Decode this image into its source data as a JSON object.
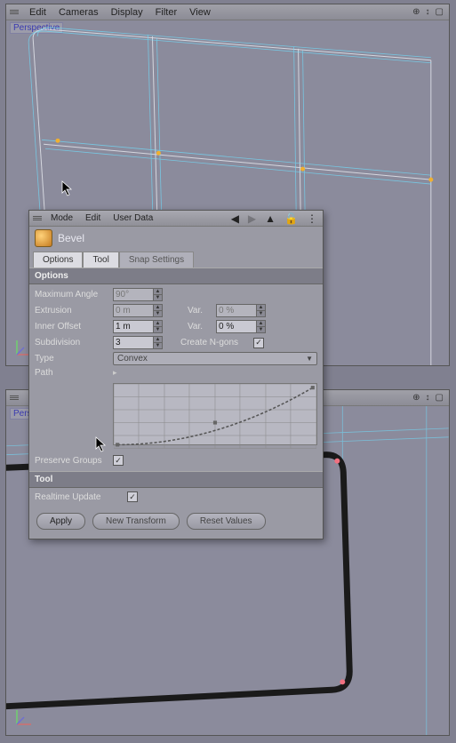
{
  "top_menu": {
    "items": [
      "Edit",
      "Cameras",
      "Display",
      "Filter",
      "View"
    ]
  },
  "viewport_label": "Perspective",
  "dialog": {
    "menus": [
      "Mode",
      "Edit",
      "User Data"
    ],
    "tool_name": "Bevel",
    "tabs": {
      "options": "Options",
      "tool": "Tool",
      "snap": "Snap Settings"
    },
    "sections": {
      "options": "Options",
      "tool": "Tool"
    },
    "params": {
      "max_angle_label": "Maximum Angle",
      "max_angle_value": "90°",
      "extrusion_label": "Extrusion",
      "extrusion_value": "0 m",
      "extrusion_var_label": "Var.",
      "extrusion_var_value": "0 %",
      "inner_offset_label": "Inner Offset",
      "inner_offset_value": "1 m",
      "inner_var_label": "Var.",
      "inner_var_value": "0 %",
      "subdivision_label": "Subdivision",
      "subdivision_value": "3",
      "ngons_label": "Create N-gons",
      "ngons_checked": true,
      "type_label": "Type",
      "type_value": "Convex",
      "path_label": "Path",
      "preserve_label": "Preserve Groups",
      "preserve_checked": true,
      "realtime_label": "Realtime Update",
      "realtime_checked": true
    },
    "buttons": {
      "apply": "Apply",
      "new_transform": "New Transform",
      "reset": "Reset Values"
    }
  }
}
